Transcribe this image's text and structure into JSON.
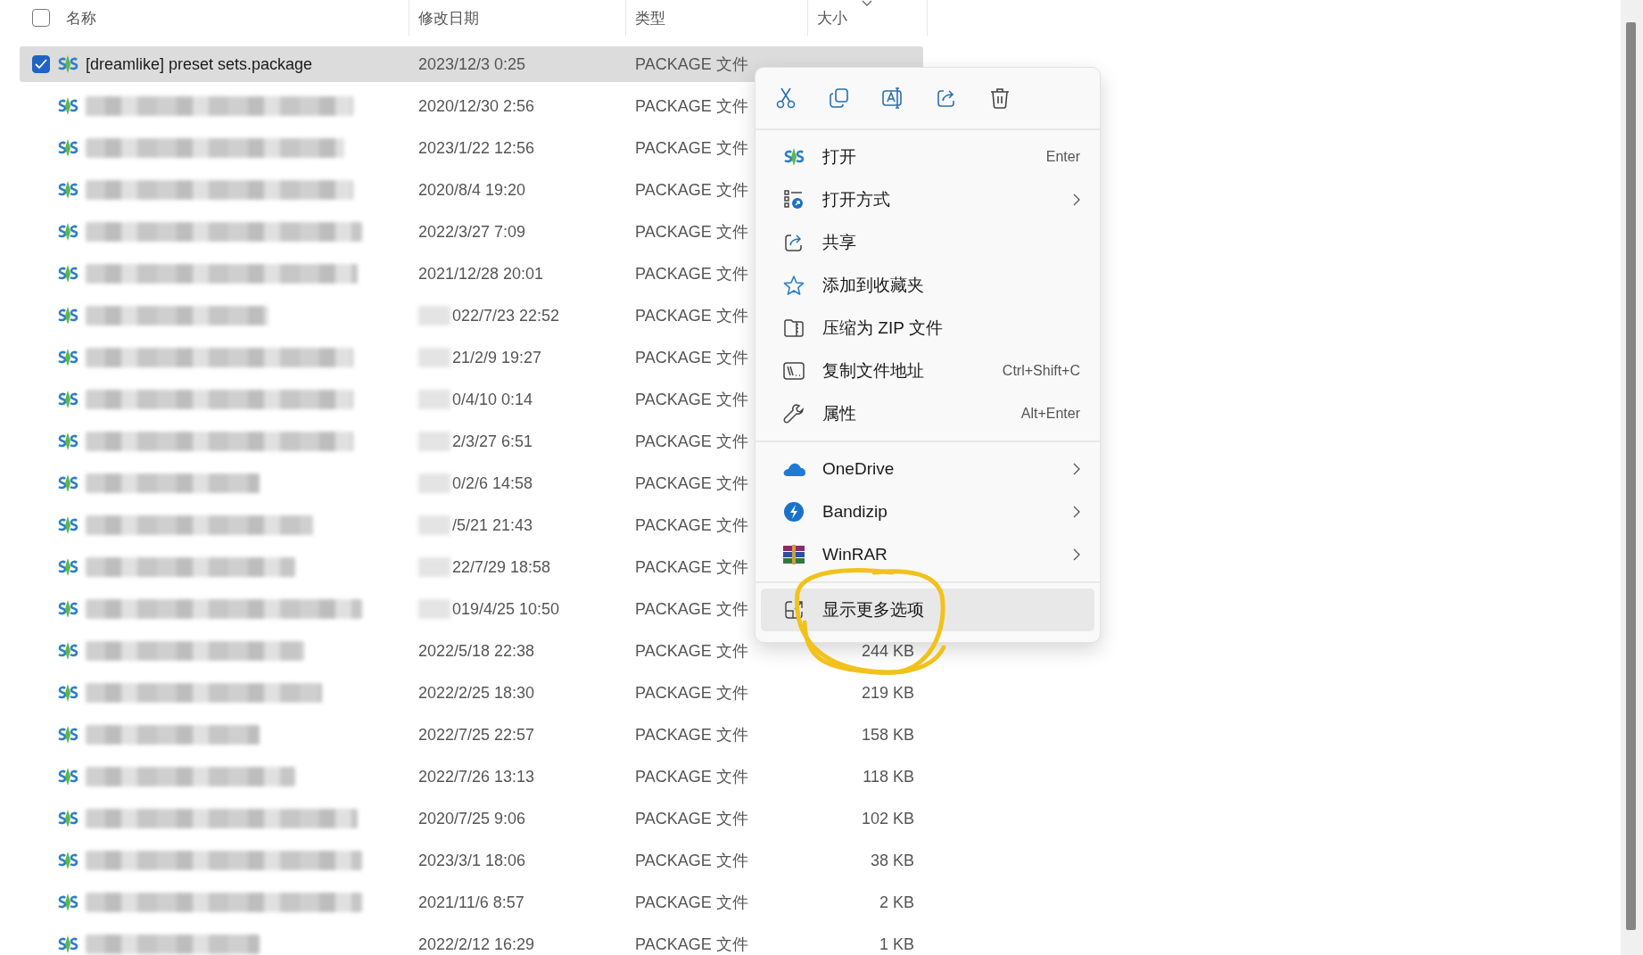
{
  "header": {
    "select_all_checked": false,
    "columns": [
      {
        "label": "名称",
        "sorted": false
      },
      {
        "label": "修改日期",
        "sorted": false
      },
      {
        "label": "类型",
        "sorted": false
      },
      {
        "label": "大小",
        "sorted": true
      }
    ]
  },
  "rows": [
    {
      "selected": true,
      "name": "[dreamlike] preset sets.package",
      "date": "2023/12/3 0:25",
      "date_redacted": false,
      "type": "PACKAGE 文件"
    },
    {
      "selected": false,
      "date": "2020/12/30 2:56",
      "date_redacted": false,
      "type": "PACKAGE 文件"
    },
    {
      "selected": false,
      "date": "2023/1/22 12:56",
      "date_redacted": false,
      "type": "PACKAGE 文件"
    },
    {
      "selected": false,
      "date": "2020/8/4 19:20",
      "date_redacted": false,
      "type": "PACKAGE 文件"
    },
    {
      "selected": false,
      "date": "2022/3/27 7:09",
      "date_redacted": false,
      "type": "PACKAGE 文件"
    },
    {
      "selected": false,
      "date": "2021/12/28 20:01",
      "date_redacted": false,
      "type": "PACKAGE 文件"
    },
    {
      "selected": false,
      "date": "022/7/23 22:52",
      "date_redacted": true,
      "type": "PACKAGE 文件"
    },
    {
      "selected": false,
      "date": "21/2/9 19:27",
      "date_redacted": true,
      "type": "PACKAGE 文件"
    },
    {
      "selected": false,
      "date": "0/4/10 0:14",
      "date_redacted": true,
      "type": "PACKAGE 文件"
    },
    {
      "selected": false,
      "date": "2/3/27 6:51",
      "date_redacted": true,
      "type": "PACKAGE 文件"
    },
    {
      "selected": false,
      "date": "0/2/6 14:58",
      "date_redacted": true,
      "type": "PACKAGE 文件"
    },
    {
      "selected": false,
      "date": "/5/21 21:43",
      "date_redacted": true,
      "type": "PACKAGE 文件"
    },
    {
      "selected": false,
      "date": "22/7/29 18:58",
      "date_redacted": true,
      "type": "PACKAGE 文件"
    },
    {
      "selected": false,
      "date": "019/4/25 10:50",
      "date_redacted": true,
      "type": "PACKAGE 文件"
    },
    {
      "selected": false,
      "date": "2022/5/18 22:38",
      "date_redacted": false,
      "type": "PACKAGE 文件",
      "size": "244 KB"
    },
    {
      "selected": false,
      "date": "2022/2/25 18:30",
      "date_redacted": false,
      "type": "PACKAGE 文件",
      "size": "219 KB"
    },
    {
      "selected": false,
      "date": "2022/7/25 22:57",
      "date_redacted": false,
      "type": "PACKAGE 文件",
      "size": "158 KB"
    },
    {
      "selected": false,
      "date": "2022/7/26 13:13",
      "date_redacted": false,
      "type": "PACKAGE 文件",
      "size": "118 KB"
    },
    {
      "selected": false,
      "date": "2020/7/25 9:06",
      "date_redacted": false,
      "type": "PACKAGE 文件",
      "size": "102 KB"
    },
    {
      "selected": false,
      "date": "2023/3/1 18:06",
      "date_redacted": false,
      "type": "PACKAGE 文件",
      "size": "38 KB"
    },
    {
      "selected": false,
      "date": "2021/11/6 8:57",
      "date_redacted": false,
      "type": "PACKAGE 文件",
      "size": "2 KB"
    },
    {
      "selected": false,
      "date": "2022/2/12 16:29",
      "date_redacted": false,
      "type": "PACKAGE 文件",
      "size": "1 KB"
    }
  ],
  "context_menu": {
    "toolbar": [
      {
        "kind": "cut"
      },
      {
        "kind": "copy"
      },
      {
        "kind": "rename"
      },
      {
        "kind": "share"
      },
      {
        "kind": "delete"
      }
    ],
    "sections": [
      {
        "items": [
          {
            "kind": "sims",
            "label": "打开",
            "shortcut": "Enter",
            "submenu": false,
            "selected": false
          },
          {
            "kind": "open-with",
            "label": "打开方式",
            "submenu": true,
            "selected": false
          },
          {
            "kind": "share",
            "label": "共享",
            "submenu": false,
            "selected": false
          },
          {
            "kind": "star",
            "label": "添加到收藏夹",
            "submenu": false,
            "selected": false
          },
          {
            "kind": "zip",
            "label": "压缩为 ZIP 文件",
            "submenu": false,
            "selected": false
          },
          {
            "kind": "path",
            "label": "复制文件地址",
            "shortcut": "Ctrl+Shift+C",
            "submenu": false,
            "selected": false
          },
          {
            "kind": "wrench",
            "label": "属性",
            "shortcut": "Alt+Enter",
            "submenu": false,
            "selected": false
          }
        ]
      },
      {
        "items": [
          {
            "kind": "cloud",
            "label": "OneDrive",
            "submenu": true,
            "selected": false
          },
          {
            "kind": "bolt",
            "label": "Bandizip",
            "submenu": true,
            "selected": false
          },
          {
            "kind": "books",
            "label": "WinRAR",
            "submenu": true,
            "selected": false
          }
        ]
      },
      {
        "items": [
          {
            "kind": "more",
            "label": "显示更多选项",
            "submenu": false,
            "selected": true
          }
        ]
      }
    ]
  }
}
